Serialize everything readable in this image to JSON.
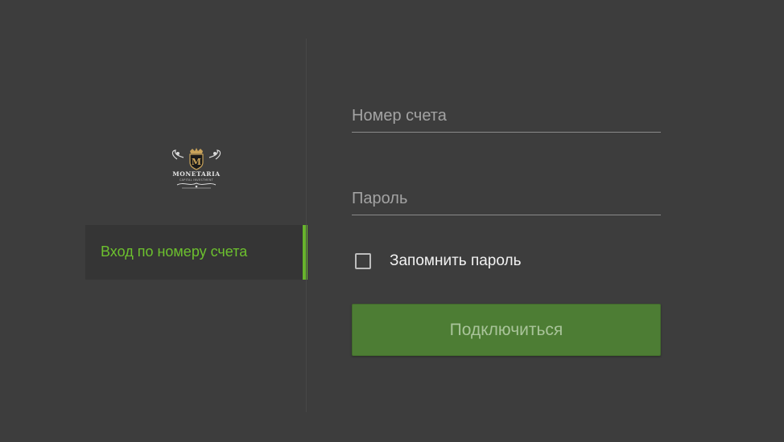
{
  "sidebar": {
    "logo": {
      "icon": "monetaria-crest-logo",
      "brand_text": "MONETARIA",
      "tagline": "CAPITAL INVESTMENT",
      "colors": {
        "gold": "#c9a35a",
        "white": "#e6e6e6"
      }
    },
    "items": [
      {
        "label": "Вход по номеру счета",
        "active": true
      }
    ]
  },
  "form": {
    "account_placeholder": "Номер счета",
    "account_value": "",
    "password_placeholder": "Пароль",
    "password_value": "",
    "remember_label": "Запомнить пароль",
    "remember_checked": false,
    "submit_label": "Подключиться"
  },
  "colors": {
    "background": "#3d3d3d",
    "panel": "#353535",
    "accent_green": "#67b52c",
    "button_green": "#4d7d34",
    "button_text": "#a9c49a"
  }
}
